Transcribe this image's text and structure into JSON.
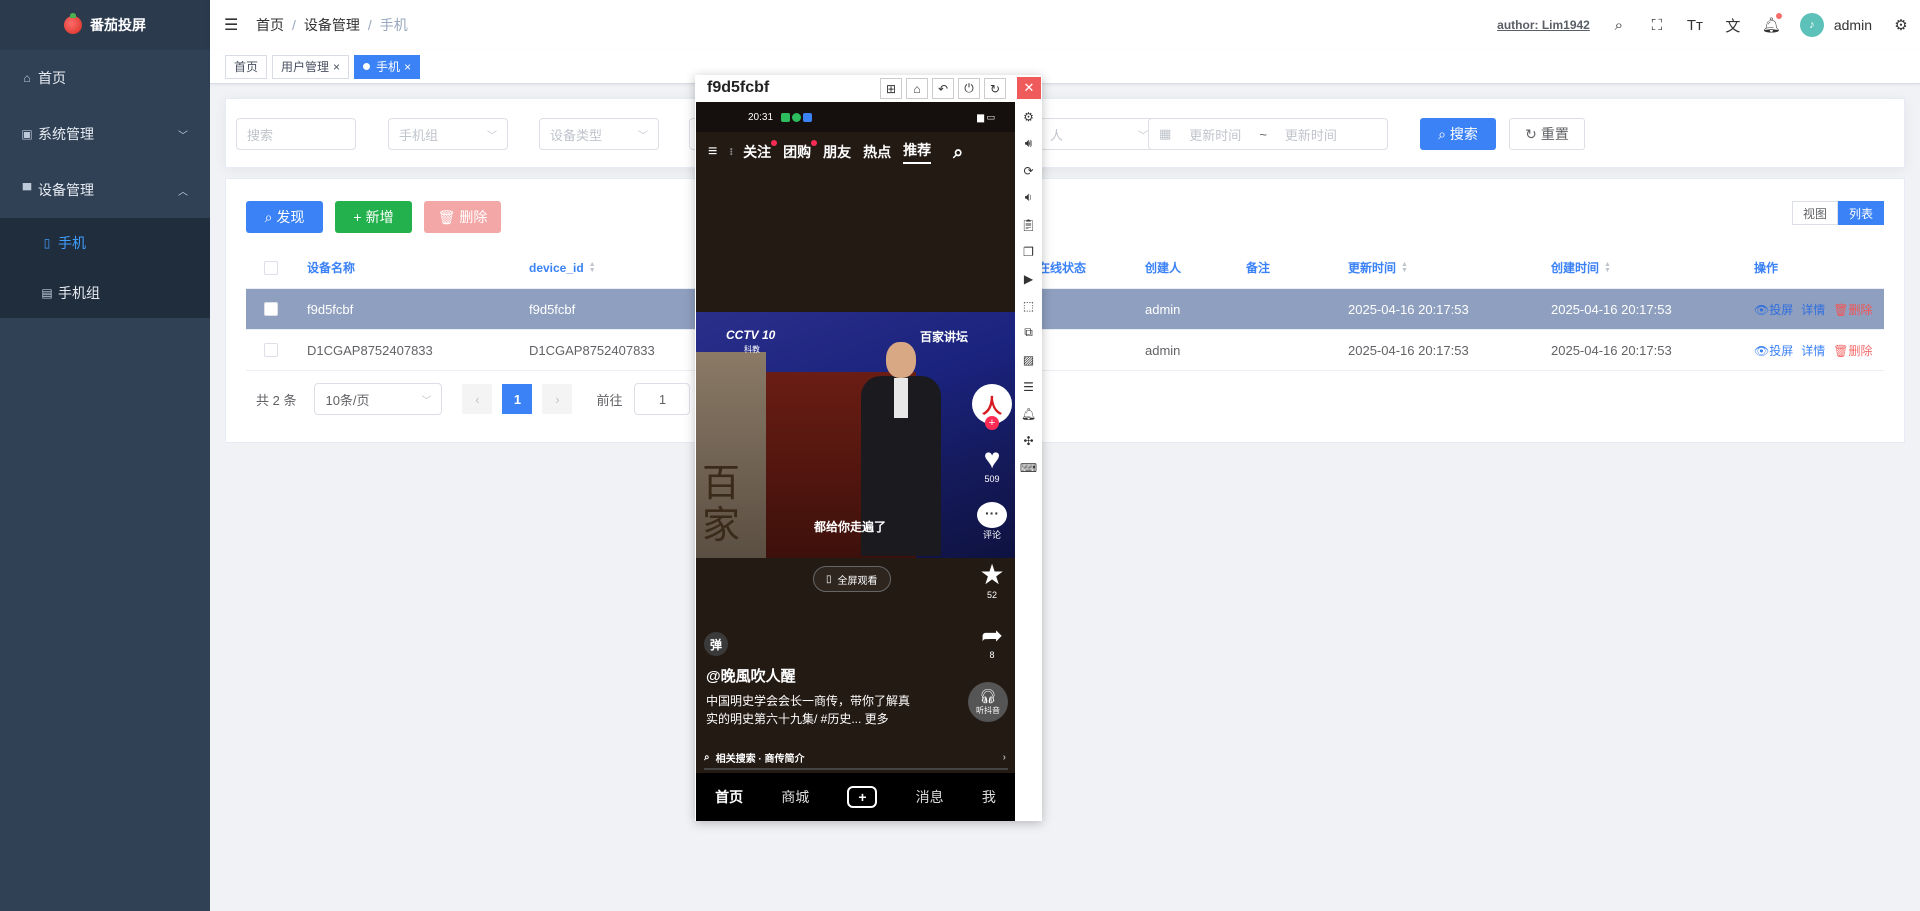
{
  "app": {
    "logo_text": "番茄投屏"
  },
  "sidebar": {
    "items": [
      {
        "label": "首页",
        "icon": "home-icon"
      },
      {
        "label": "系统管理",
        "icon": "system-icon"
      },
      {
        "label": "设备管理",
        "icon": "monitor-icon"
      }
    ],
    "sub_items": [
      {
        "label": "手机",
        "icon": "phone-icon",
        "active": true
      },
      {
        "label": "手机组",
        "icon": "group-icon"
      }
    ]
  },
  "header": {
    "breadcrumb": [
      "首页",
      "设备管理",
      "手机"
    ],
    "author": "author: Lim1942",
    "user": "admin"
  },
  "tags": [
    {
      "label": "首页"
    },
    {
      "label": "用户管理"
    },
    {
      "label": "手机",
      "active": true
    }
  ],
  "search": {
    "keyword_placeholder": "搜索",
    "group_placeholder": "手机组",
    "type_placeholder": "设备类型",
    "creator_placeholder": "人",
    "update_from": "更新时间",
    "range_sep": "~",
    "update_to": "更新时间",
    "search_btn": "搜索",
    "reset_btn": "重置"
  },
  "toolbar": {
    "discover": "发现",
    "add": "新增",
    "delete": "删除",
    "view": "视图",
    "list": "列表"
  },
  "table": {
    "columns": [
      "设备名称",
      "device_id",
      "在线状态",
      "创建人",
      "备注",
      "更新时间",
      "创建时间",
      "操作"
    ],
    "rows": [
      {
        "name": "f9d5fcbf",
        "device_id": "f9d5fcbf",
        "creator": "admin",
        "remark": "",
        "updated": "2025-04-16 20:17:53",
        "created": "2025-04-16 20:17:53",
        "selected": true
      },
      {
        "name": "D1CGAP8752407833",
        "device_id": "D1CGAP8752407833",
        "creator": "admin",
        "remark": "",
        "updated": "2025-04-16 20:17:53",
        "created": "2025-04-16 20:17:53",
        "selected": false
      }
    ],
    "ops": {
      "cast": "投屏",
      "detail": "详情",
      "delete": "删除"
    }
  },
  "pager": {
    "total": "共 2 条",
    "size": "10条/页",
    "current": "1",
    "goto_label": "前往",
    "goto_value": "1"
  },
  "phone_window": {
    "title": "f9d5fcbf",
    "screen": {
      "time": "20:31",
      "tabs": [
        "关注",
        "团购",
        "朋友",
        "热点",
        "推荐"
      ],
      "channel": "CCTV 10",
      "channel_sub": "科教",
      "program": "百家讲坛",
      "subtitle": "都给你走遍了",
      "fullscreen": "全屏观看",
      "like_count": "509",
      "comment_label": "评论",
      "fav_count": "52",
      "share_count": "8",
      "danmu": "弹",
      "author": "@晚風吹人醒",
      "desc_line1": "中国明史学会会长一商传，带你了解真",
      "desc_line2": "实的明史第六十九集/ #历史... 更多",
      "listen": "听抖音",
      "related": "相关搜索 · 商传简介",
      "bottom_tabs": [
        "首页",
        "商城",
        "消息",
        "我"
      ]
    }
  },
  "colors": {
    "primary": "#3b82f6",
    "sidebar": "#304156",
    "danger": "#f56c6c",
    "success": "#22b14c"
  }
}
